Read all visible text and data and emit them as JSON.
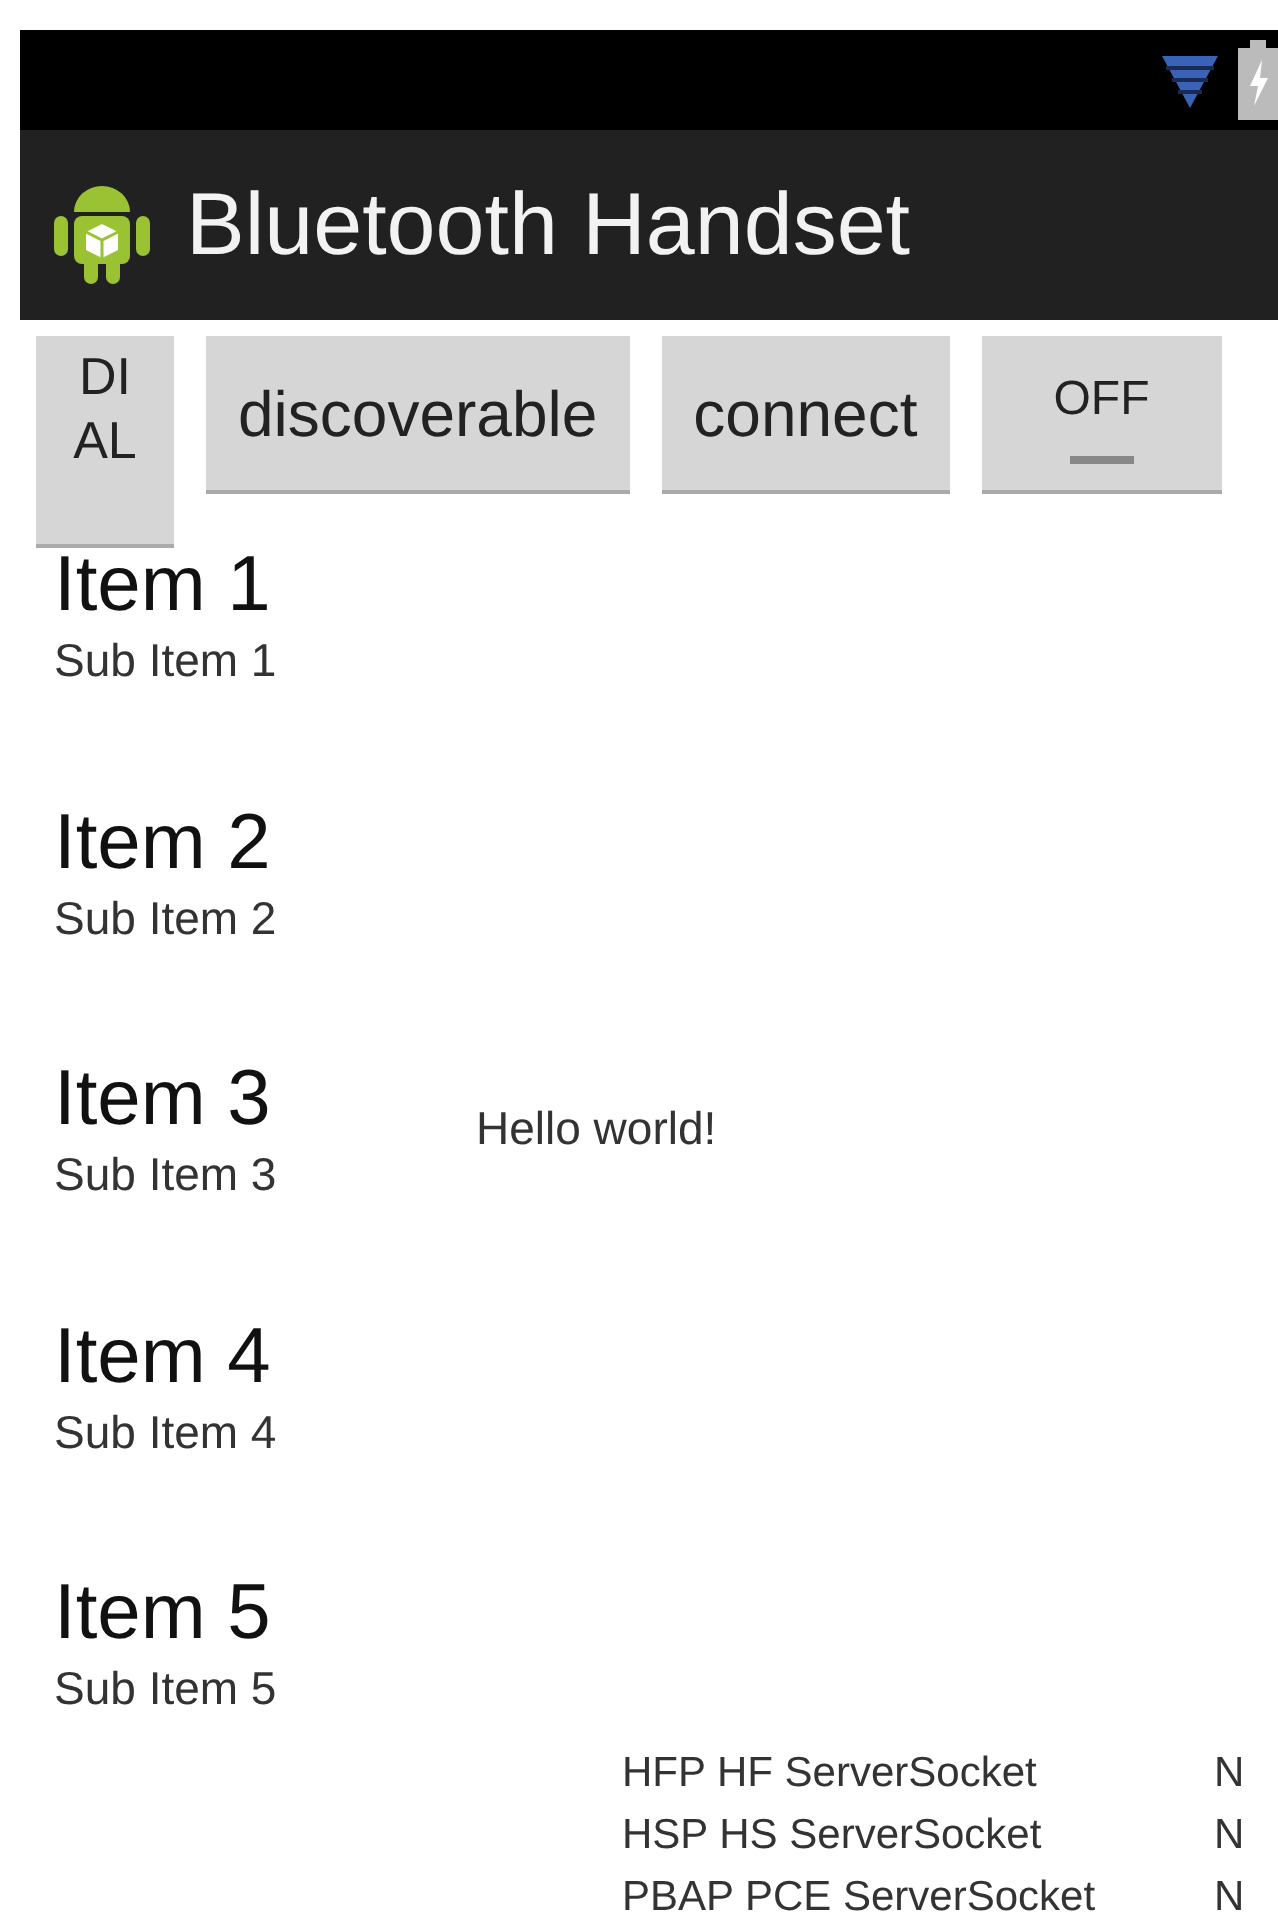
{
  "action_bar": {
    "title": "Bluetooth Handset"
  },
  "buttons": [
    {
      "kind": "button",
      "label": "DIAL"
    },
    {
      "kind": "button",
      "label": "discoverable"
    },
    {
      "kind": "button",
      "label": "connect"
    },
    {
      "kind": "toggle",
      "label": "OFF",
      "on": false
    }
  ],
  "list": [
    {
      "title": "Item 1",
      "subtitle": "Sub Item 1"
    },
    {
      "title": "Item 2",
      "subtitle": "Sub Item 2"
    },
    {
      "title": "Item 3",
      "subtitle": "Sub Item 3"
    },
    {
      "title": "Item 4",
      "subtitle": "Sub Item 4"
    },
    {
      "title": "Item 5",
      "subtitle": "Sub Item 5"
    }
  ],
  "message": "Hello world!",
  "sockets": [
    {
      "name": "HFP HF ServerSocket",
      "status": "N"
    },
    {
      "name": "HSP HS ServerSocket",
      "status": "N"
    },
    {
      "name": "PBAP PCE ServerSocket",
      "status": "N"
    }
  ]
}
